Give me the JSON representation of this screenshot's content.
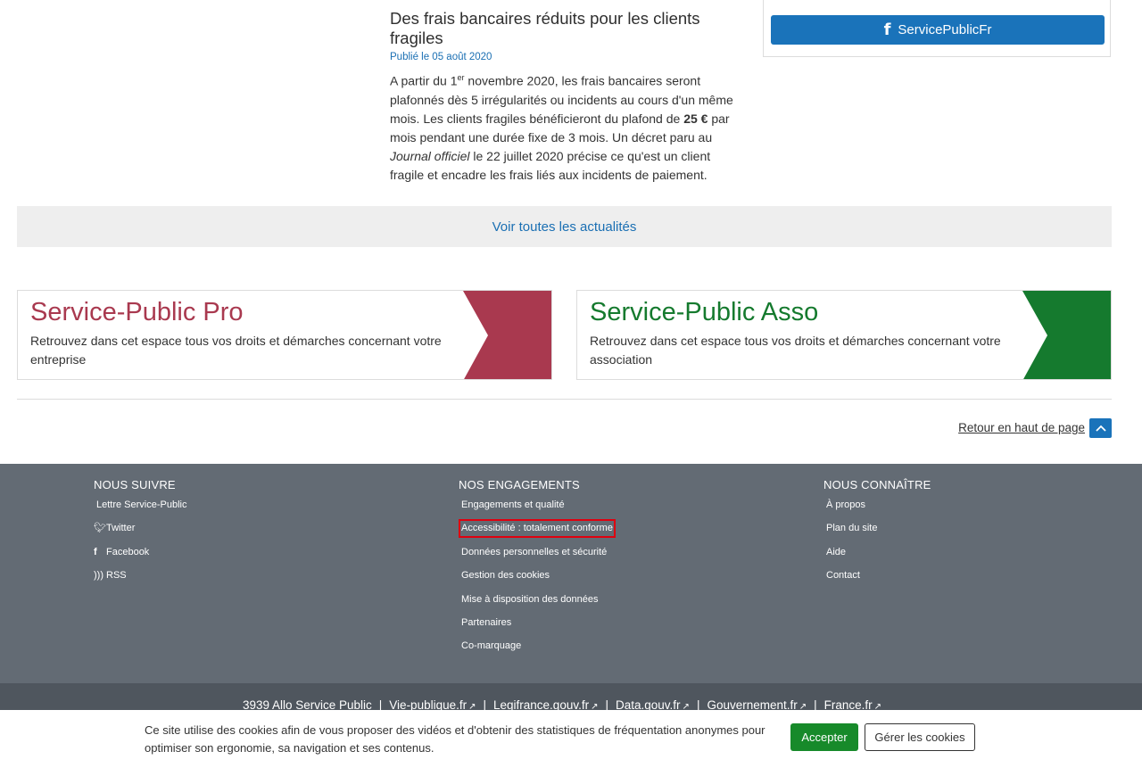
{
  "news": {
    "title": "Des frais bancaires réduits pour les clients fragiles",
    "date": "Publié le 05 août 2020",
    "body_1": "A partir du 1",
    "body_sup": "er",
    "body_2": " novembre 2020, les frais bancaires seront plafonnés dès 5 irrégularités ou incidents au cours d'un même mois. Les clients fragiles bénéficieront du plafond de ",
    "body_bold": "25 €",
    "body_3": " par mois pendant une durée fixe de 3 mois. Un décret paru au ",
    "body_italic": "Journal officiel",
    "body_4": " le 22 juillet 2020 précise ce qu'est un client fragile et encadre les frais liés aux incidents de paiement."
  },
  "social_box": {
    "facebook_label": "ServicePublicFr"
  },
  "see_all": "Voir toutes les actualités",
  "promo_pro": {
    "title": "Service-Public Pro",
    "description": "Retrouvez dans cet espace tous vos droits et démarches concernant votre entreprise",
    "color": "#a9394f"
  },
  "promo_asso": {
    "title": "Service-Public Asso",
    "description": "Retrouvez dans cet espace tous vos droits et démarches concernant votre association",
    "color": "#157a2e"
  },
  "back_to_top": "Retour en haut de page",
  "footer": {
    "follow": {
      "heading": "NOUS SUIVRE",
      "items": [
        "Lettre Service-Public",
        "Twitter",
        "Facebook",
        "RSS"
      ]
    },
    "commitments": {
      "heading": "NOS ENGAGEMENTS",
      "items": [
        "Engagements et qualité",
        "Accessibilité : totalement conforme",
        "Données personnelles et sécurité",
        "Gestion des cookies",
        "Mise à disposition des données",
        "Partenaires",
        "Co-marquage"
      ]
    },
    "about": {
      "heading": "NOUS CONNAÎTRE",
      "items": [
        "À propos",
        "Plan du site",
        "Aide",
        "Contact"
      ]
    }
  },
  "bottom_links": {
    "allo": "3939 Allo Service Public",
    "items": [
      "Vie-publique.fr",
      "Legifrance.gouv.fr",
      "Data.gouv.fr",
      "Gouvernement.fr",
      "France.fr"
    ]
  },
  "cookie_banner": {
    "text": "Ce site utilise des cookies afin de vous proposer des vidéos et d'obtenir des statistiques de fréquentation anonymes pour optimiser son ergonomie, sa navigation et ses contenus.",
    "accept": "Accepter",
    "manage": "Gérer les cookies"
  }
}
